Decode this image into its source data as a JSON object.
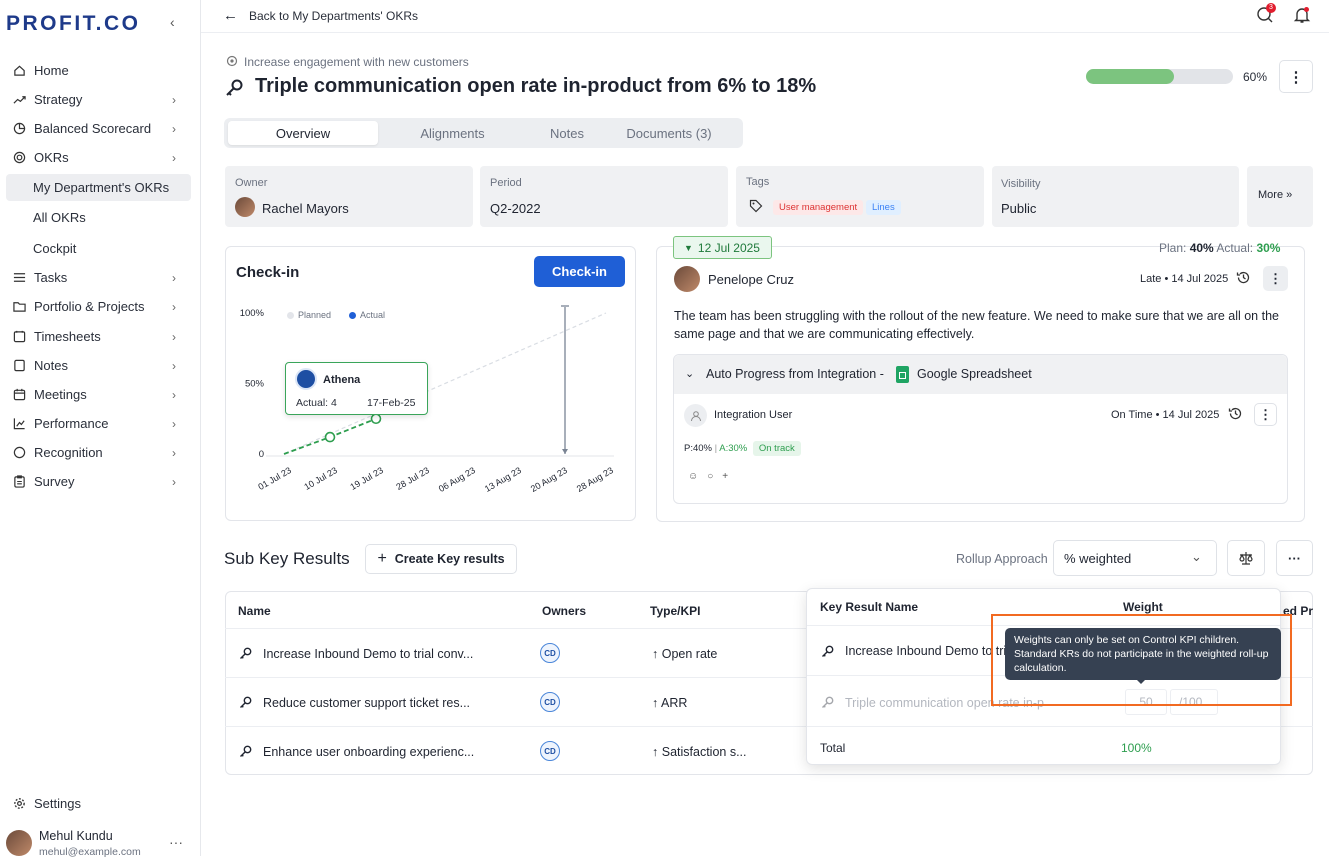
{
  "sidebar": {
    "logo": "PROFIT.CO",
    "items": [
      {
        "label": "Home",
        "icon": "home-icon"
      },
      {
        "label": "Strategy",
        "icon": "trend-icon"
      },
      {
        "label": "Balanced Scorecard",
        "icon": "pie-icon"
      },
      {
        "label": "OKRs",
        "icon": "target-icon"
      },
      {
        "label": "My Department's OKRs"
      },
      {
        "label": "All OKRs"
      },
      {
        "label": "Cockpit"
      },
      {
        "label": "Tasks",
        "icon": "list-icon"
      },
      {
        "label": "Portfolio & Projects",
        "icon": "folder-icon"
      },
      {
        "label": "Timesheets",
        "icon": "clock-icon"
      },
      {
        "label": "Notes",
        "icon": "note-icon"
      },
      {
        "label": "Meetings",
        "icon": "calendar-icon"
      },
      {
        "label": "Performance",
        "icon": "chart-icon"
      },
      {
        "label": "Recognition",
        "icon": "circle-icon"
      },
      {
        "label": "Survey",
        "icon": "clipboard-icon"
      }
    ],
    "settings": "Settings",
    "user": {
      "name": "Mehul Kundu",
      "email": "mehul@example.com"
    }
  },
  "topbar": {
    "back": "Back to My Departments' OKRs",
    "chat_badge": "3"
  },
  "header": {
    "objective": "Increase engagement with new customers",
    "title": "Triple communication open rate in-product from 6% to 18%",
    "progress": 0.6,
    "progress_label": "60%"
  },
  "tabs": [
    "Overview",
    "Alignments",
    "Notes",
    "Documents (3)"
  ],
  "meta": {
    "owner_label": "Owner",
    "owner": "Rachel Mayors",
    "period_label": "Period",
    "period": "Q2-2022",
    "tags_label": "Tags",
    "tag1": "User management",
    "tag2": "Lines",
    "visibility_label": "Visibility",
    "visibility": "Public",
    "more": "More"
  },
  "checkin": {
    "title": "Check-in",
    "button": "Check-in",
    "legend_planned": "Planned",
    "legend_actual": "Actual",
    "tooltip_name": "Athena",
    "tooltip_actual": "Actual: 4",
    "tooltip_date": "17-Feb-25"
  },
  "chart_data": {
    "type": "line",
    "yticks": [
      "100%",
      "50%",
      "0"
    ],
    "categories": [
      "01 Jul 23",
      "10 Jul 23",
      "19 Jul 23",
      "28 Jul 23",
      "06 Aug 23",
      "13 Aug 23",
      "20 Aug 23",
      "28 Aug 23"
    ],
    "ylim": [
      0,
      100
    ],
    "series": [
      {
        "name": "Planned",
        "x": [
          "01 Jul 23",
          "28 Aug 23"
        ],
        "values": [
          0,
          100
        ]
      },
      {
        "name": "Actual",
        "x": [
          "01 Jul 23",
          "10 Jul 23",
          "19 Jul 23"
        ],
        "values": [
          0,
          12,
          25
        ]
      }
    ],
    "marker_line": "20 Aug 23",
    "colors": {
      "planned": "#d9dde3",
      "actual": "#2e9e4f"
    }
  },
  "checkin_detail": {
    "date": "12 Jul 2025",
    "plan_label": "Plan:",
    "plan": "40%",
    "actual_label": "Actual:",
    "actual": "30%",
    "user": "Penelope Cruz",
    "status": "Late • 14 Jul 2025",
    "comment": "The team has been struggling with the rollout of the new feature. We need to make sure that we are all on the same page and that we are communicating effectively.",
    "integration_title": "Auto Progress from Integration -",
    "integration_app": "Google Spreadsheet",
    "integration_user": "Integration User",
    "integration_status": "On Time • 14 Jul 2025",
    "p": "P:40%",
    "a": "A:30%",
    "track": "On track"
  },
  "sub_kr": {
    "title": "Sub Key Results",
    "create": "Create Key results",
    "rollup_label": "Rollup Approach",
    "rollup_value": "% weighted",
    "columns": [
      "Name",
      "Owners",
      "Type/KPI"
    ],
    "rows": [
      {
        "name": "Increase Inbound Demo to trial conv...",
        "owner": "CD",
        "kpi": "Open rate"
      },
      {
        "name": "Reduce customer support ticket res...",
        "owner": "CD",
        "kpi": "ARR"
      },
      {
        "name": "Enhance user onboarding experienc...",
        "owner": "CD",
        "kpi": "Satisfaction s..."
      }
    ],
    "hidden_col_partial": "ed Pro"
  },
  "weights": {
    "col_name": "Key Result Name",
    "col_weight": "Weight",
    "row1": "Increase Inbound Demo to tri",
    "row2": "Triple communication open rate in-p",
    "row2_weight": "50",
    "row2_max": "/100",
    "total_label": "Total",
    "total": "100%",
    "tooltip": "Weights can only be set on Control KPI children. Standard KRs do not participate in the weighted roll-up calculation."
  }
}
